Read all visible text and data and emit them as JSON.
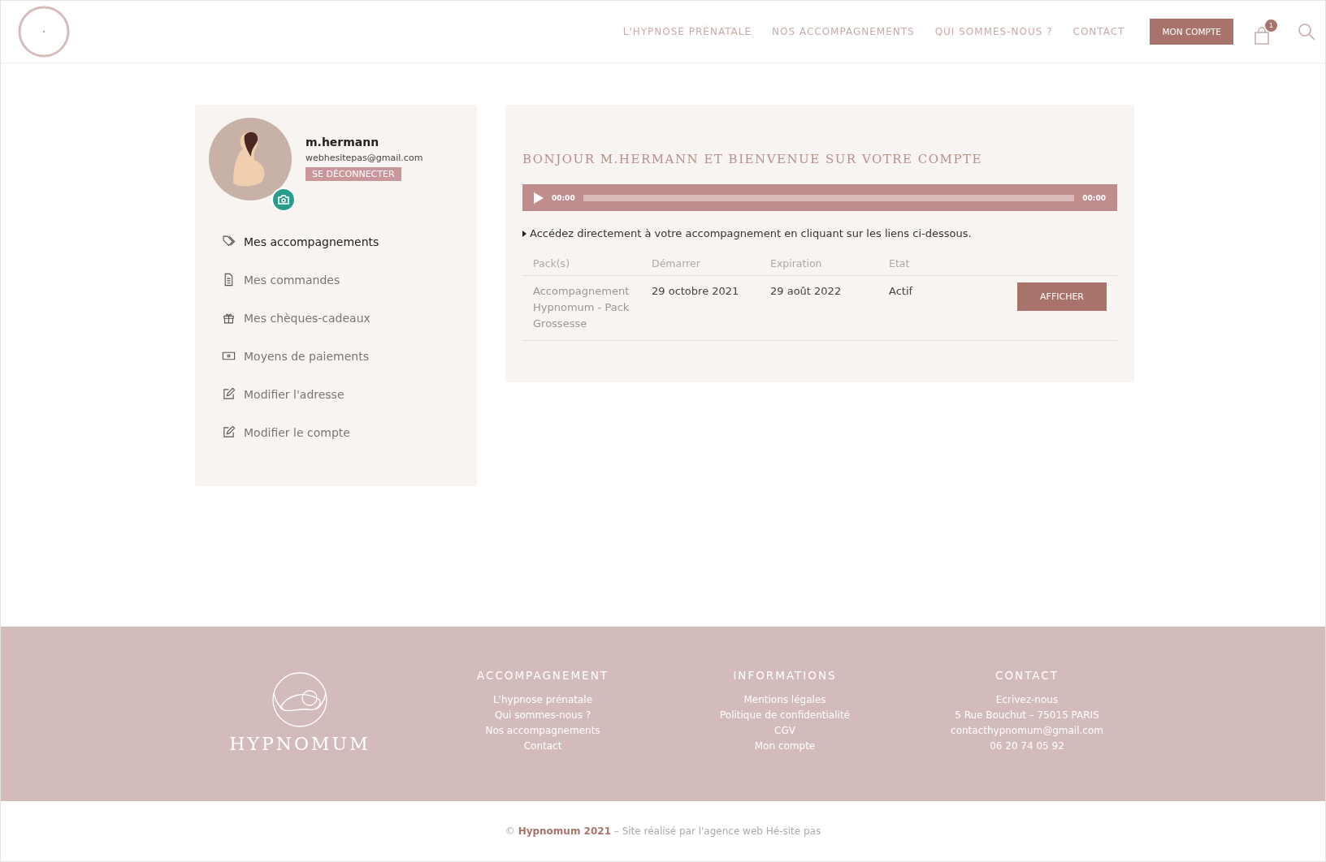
{
  "header": {
    "nav": [
      {
        "label": "L'HYPNOSE PRÉNATALE"
      },
      {
        "label": "NOS ACCOMPAGNEMENTS"
      },
      {
        "label": "QUI SOMMES-NOUS ?"
      },
      {
        "label": "CONTACT"
      }
    ],
    "account_button": "MON COMPTE",
    "cart_count": "1"
  },
  "profile": {
    "username": "m.hermann",
    "email": "webhesitepas@gmail.com",
    "logout": "SE DÉCONNECTER"
  },
  "menu": [
    {
      "label": "Mes accompagnements",
      "kind": "tag",
      "selected": true
    },
    {
      "label": "Mes commandes",
      "kind": "document",
      "selected": false
    },
    {
      "label": "Mes chèques-cadeaux",
      "kind": "gift",
      "selected": false
    },
    {
      "label": "Moyens de paiements",
      "kind": "money",
      "selected": false
    },
    {
      "label": "Modifier l'adresse",
      "kind": "edit",
      "selected": false
    },
    {
      "label": "Modifier le compte",
      "kind": "edit",
      "selected": false
    }
  ],
  "main": {
    "title": "BONJOUR M.HERMANN ET BIENVENUE SUR VOTRE COMPTE",
    "audio": {
      "current": "00:00",
      "duration": "00:00"
    },
    "intro": "Accédez directement à votre accompagnement en cliquant sur les liens ci-dessous.",
    "table": {
      "columns": [
        "Pack(s)",
        "Démarrer",
        "Expiration",
        "Etat"
      ],
      "rows": [
        {
          "pack": "Accompagnement Hypnomum - Pack Grossesse",
          "start": "29 octobre 2021",
          "end": "29 août 2022",
          "state": "Actif",
          "action": "AFFICHER"
        }
      ]
    }
  },
  "footer": {
    "logo": "HYPNOMUM",
    "columns": [
      {
        "title": "ACCOMPAGNEMENT",
        "links": [
          "L'hypnose prénatale",
          "Qui sommes-nous ?",
          "Nos accompagnements",
          "Contact"
        ]
      },
      {
        "title": "INFORMATIONS",
        "links": [
          "Mentions légales",
          "Politique de confidentialité",
          "CGV",
          "Mon compte"
        ]
      },
      {
        "title": "CONTACT",
        "links": [
          "Ecrivez-nous",
          "5 Rue Bouchut  – 75015 PARIS",
          "contacthypnomum@gmail.com",
          "06 20 74 05 92"
        ]
      }
    ],
    "copyright": "© **Hypnomum 2021**  –  Site réalisé par l'agence web Hé-site pas"
  }
}
